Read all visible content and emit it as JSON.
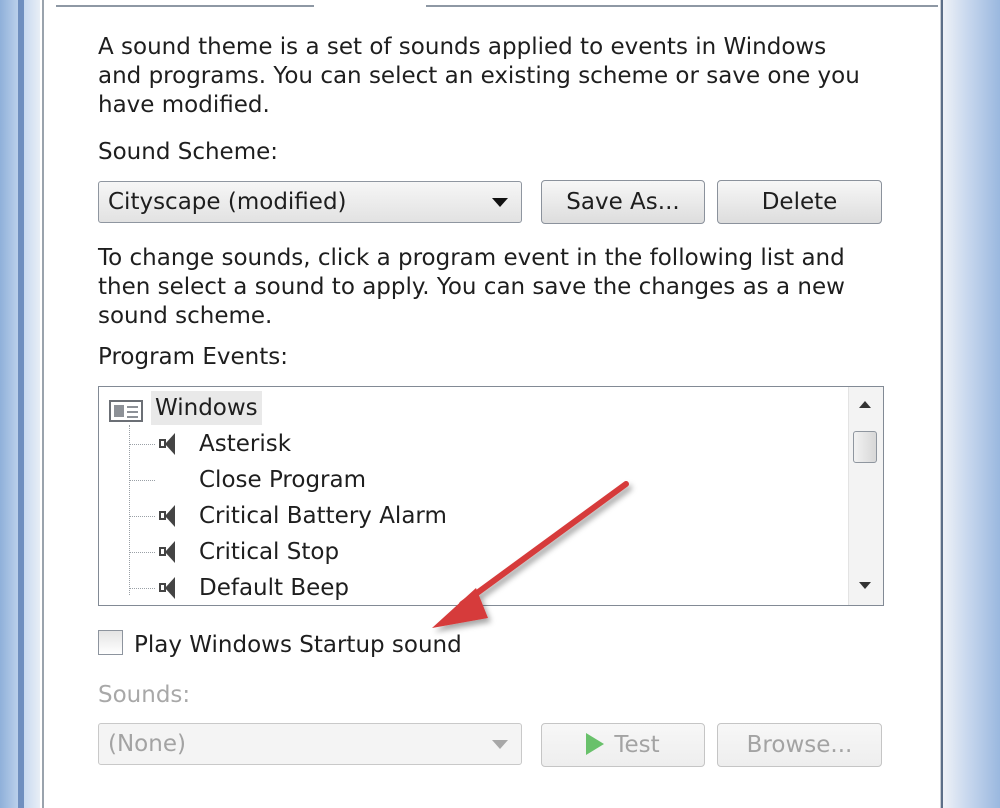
{
  "description": "A sound theme is a set of sounds applied to events in Windows and programs.  You can select an existing scheme or save one you have modified.",
  "description_lines": [
    "A sound theme is a set of sounds applied to events in Windows",
    "and programs.  You can select an existing scheme or save one you",
    "have modified."
  ],
  "scheme": {
    "label": "Sound Scheme:",
    "selected": "Cityscape (modified)",
    "save_as_label": "Save As...",
    "delete_label": "Delete"
  },
  "instructions_lines": [
    "To change sounds, click a program event in the following list and",
    "then select a sound to apply.  You can save the changes as a new",
    "sound scheme."
  ],
  "events": {
    "label": "Program Events:",
    "group": "Windows",
    "items": [
      {
        "label": "Asterisk",
        "icon": "speaker-icon",
        "has_sound": true
      },
      {
        "label": "Close Program",
        "icon": "",
        "has_sound": false
      },
      {
        "label": "Critical Battery Alarm",
        "icon": "speaker-icon",
        "has_sound": true
      },
      {
        "label": "Critical Stop",
        "icon": "speaker-icon",
        "has_sound": true
      },
      {
        "label": "Default Beep",
        "icon": "speaker-icon",
        "has_sound": true
      }
    ]
  },
  "startup": {
    "label": "Play Windows Startup sound",
    "checked": false
  },
  "sounds": {
    "label": "Sounds:",
    "selected": "(None)",
    "test_label": "Test",
    "browse_label": "Browse..."
  },
  "colors": {
    "arrow": "#d63a3a",
    "play_icon": "#69c16b",
    "frame_blue": "#8fb0d9"
  }
}
